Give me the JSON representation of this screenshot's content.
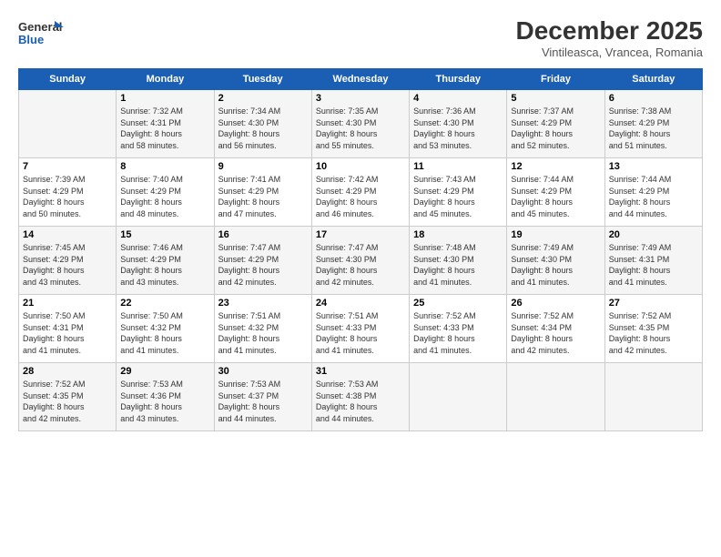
{
  "header": {
    "logo_line1": "General",
    "logo_line2": "Blue",
    "month": "December 2025",
    "location": "Vintileasca, Vrancea, Romania"
  },
  "weekdays": [
    "Sunday",
    "Monday",
    "Tuesday",
    "Wednesday",
    "Thursday",
    "Friday",
    "Saturday"
  ],
  "weeks": [
    [
      {
        "day": "",
        "info": ""
      },
      {
        "day": "1",
        "info": "Sunrise: 7:32 AM\nSunset: 4:31 PM\nDaylight: 8 hours\nand 58 minutes."
      },
      {
        "day": "2",
        "info": "Sunrise: 7:34 AM\nSunset: 4:30 PM\nDaylight: 8 hours\nand 56 minutes."
      },
      {
        "day": "3",
        "info": "Sunrise: 7:35 AM\nSunset: 4:30 PM\nDaylight: 8 hours\nand 55 minutes."
      },
      {
        "day": "4",
        "info": "Sunrise: 7:36 AM\nSunset: 4:30 PM\nDaylight: 8 hours\nand 53 minutes."
      },
      {
        "day": "5",
        "info": "Sunrise: 7:37 AM\nSunset: 4:29 PM\nDaylight: 8 hours\nand 52 minutes."
      },
      {
        "day": "6",
        "info": "Sunrise: 7:38 AM\nSunset: 4:29 PM\nDaylight: 8 hours\nand 51 minutes."
      }
    ],
    [
      {
        "day": "7",
        "info": "Sunrise: 7:39 AM\nSunset: 4:29 PM\nDaylight: 8 hours\nand 50 minutes."
      },
      {
        "day": "8",
        "info": "Sunrise: 7:40 AM\nSunset: 4:29 PM\nDaylight: 8 hours\nand 48 minutes."
      },
      {
        "day": "9",
        "info": "Sunrise: 7:41 AM\nSunset: 4:29 PM\nDaylight: 8 hours\nand 47 minutes."
      },
      {
        "day": "10",
        "info": "Sunrise: 7:42 AM\nSunset: 4:29 PM\nDaylight: 8 hours\nand 46 minutes."
      },
      {
        "day": "11",
        "info": "Sunrise: 7:43 AM\nSunset: 4:29 PM\nDaylight: 8 hours\nand 45 minutes."
      },
      {
        "day": "12",
        "info": "Sunrise: 7:44 AM\nSunset: 4:29 PM\nDaylight: 8 hours\nand 45 minutes."
      },
      {
        "day": "13",
        "info": "Sunrise: 7:44 AM\nSunset: 4:29 PM\nDaylight: 8 hours\nand 44 minutes."
      }
    ],
    [
      {
        "day": "14",
        "info": "Sunrise: 7:45 AM\nSunset: 4:29 PM\nDaylight: 8 hours\nand 43 minutes."
      },
      {
        "day": "15",
        "info": "Sunrise: 7:46 AM\nSunset: 4:29 PM\nDaylight: 8 hours\nand 43 minutes."
      },
      {
        "day": "16",
        "info": "Sunrise: 7:47 AM\nSunset: 4:29 PM\nDaylight: 8 hours\nand 42 minutes."
      },
      {
        "day": "17",
        "info": "Sunrise: 7:47 AM\nSunset: 4:30 PM\nDaylight: 8 hours\nand 42 minutes."
      },
      {
        "day": "18",
        "info": "Sunrise: 7:48 AM\nSunset: 4:30 PM\nDaylight: 8 hours\nand 41 minutes."
      },
      {
        "day": "19",
        "info": "Sunrise: 7:49 AM\nSunset: 4:30 PM\nDaylight: 8 hours\nand 41 minutes."
      },
      {
        "day": "20",
        "info": "Sunrise: 7:49 AM\nSunset: 4:31 PM\nDaylight: 8 hours\nand 41 minutes."
      }
    ],
    [
      {
        "day": "21",
        "info": "Sunrise: 7:50 AM\nSunset: 4:31 PM\nDaylight: 8 hours\nand 41 minutes."
      },
      {
        "day": "22",
        "info": "Sunrise: 7:50 AM\nSunset: 4:32 PM\nDaylight: 8 hours\nand 41 minutes."
      },
      {
        "day": "23",
        "info": "Sunrise: 7:51 AM\nSunset: 4:32 PM\nDaylight: 8 hours\nand 41 minutes."
      },
      {
        "day": "24",
        "info": "Sunrise: 7:51 AM\nSunset: 4:33 PM\nDaylight: 8 hours\nand 41 minutes."
      },
      {
        "day": "25",
        "info": "Sunrise: 7:52 AM\nSunset: 4:33 PM\nDaylight: 8 hours\nand 41 minutes."
      },
      {
        "day": "26",
        "info": "Sunrise: 7:52 AM\nSunset: 4:34 PM\nDaylight: 8 hours\nand 42 minutes."
      },
      {
        "day": "27",
        "info": "Sunrise: 7:52 AM\nSunset: 4:35 PM\nDaylight: 8 hours\nand 42 minutes."
      }
    ],
    [
      {
        "day": "28",
        "info": "Sunrise: 7:52 AM\nSunset: 4:35 PM\nDaylight: 8 hours\nand 42 minutes."
      },
      {
        "day": "29",
        "info": "Sunrise: 7:53 AM\nSunset: 4:36 PM\nDaylight: 8 hours\nand 43 minutes."
      },
      {
        "day": "30",
        "info": "Sunrise: 7:53 AM\nSunset: 4:37 PM\nDaylight: 8 hours\nand 44 minutes."
      },
      {
        "day": "31",
        "info": "Sunrise: 7:53 AM\nSunset: 4:38 PM\nDaylight: 8 hours\nand 44 minutes."
      },
      {
        "day": "",
        "info": ""
      },
      {
        "day": "",
        "info": ""
      },
      {
        "day": "",
        "info": ""
      }
    ]
  ]
}
